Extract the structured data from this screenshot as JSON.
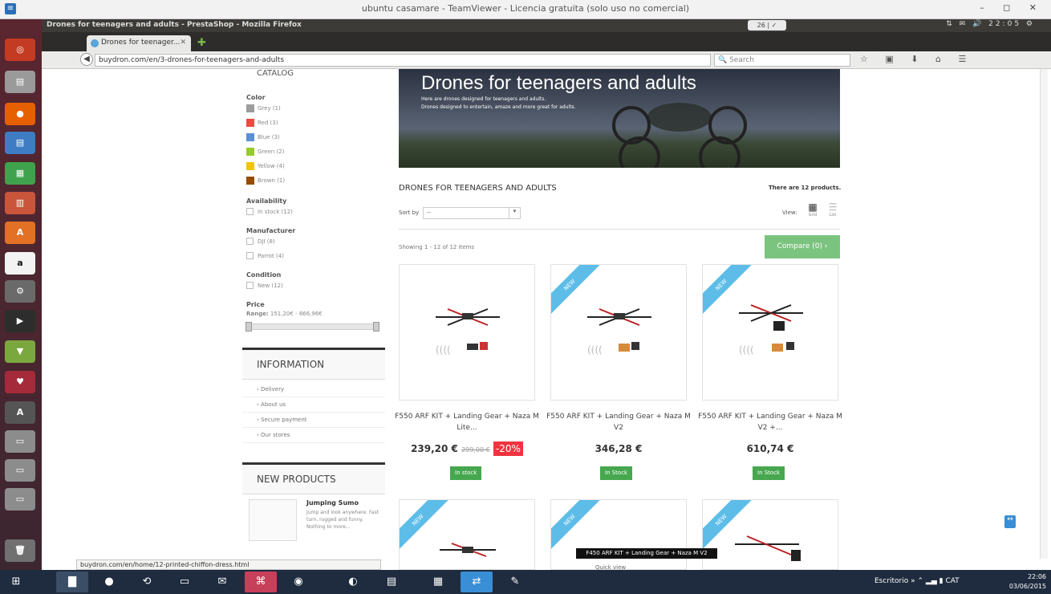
{
  "outer_window": {
    "title": "ubuntu casamare - TeamViewer - Licencia gratuita (solo uso no comercial)",
    "icon": "teamviewer-icon"
  },
  "firefox": {
    "window_title": "Drones for teenagers and adults - PrestaShop - Mozilla Firefox",
    "keyboard_indicator": "26 | ✓",
    "tray_time": "22:05",
    "tab_label": "Drones for teenager...",
    "url": "buydron.com/en/3-drones-for-teenagers-and-adults",
    "search_placeholder": "Search",
    "status_url": "buydron.com/en/home/12-printed-chiffon-dress.html"
  },
  "page": {
    "banner_title": "Drones for teenagers and adults",
    "banner_line1": "Here are drones designed for teenagers and adults.",
    "banner_line2": "Drones designed to entertain, amaze and more great for adults.",
    "category_heading": "DRONES FOR TEENAGERS AND ADULTS",
    "product_count": "There are 12 products.",
    "sort_label": "Sort by",
    "sort_value": "--",
    "view_label": "View:",
    "view_grid": "Grid",
    "view_list": "List",
    "showing": "Showing 1 - 12 of 12 items",
    "compare_button": "Compare (0)"
  },
  "sidebar": {
    "catalog_title": "CATALOG",
    "color_label": "Color",
    "colors": [
      {
        "label": "Grey (1)",
        "hex": "#9c9c9c"
      },
      {
        "label": "Red (3)",
        "hex": "#e84c3d"
      },
      {
        "label": "Blue (3)",
        "hex": "#5b8fd6"
      },
      {
        "label": "Green (2)",
        "hex": "#96ca2d"
      },
      {
        "label": "Yellow (4)",
        "hex": "#f1c40f"
      },
      {
        "label": "Brown (1)",
        "hex": "#964b00"
      }
    ],
    "availability_label": "Availability",
    "availability_option": "In stock (12)",
    "manufacturer_label": "Manufacturer",
    "manufacturers": [
      "DJI (8)",
      "Parrot (4)"
    ],
    "condition_label": "Condition",
    "condition_option": "New (12)",
    "price_label": "Price",
    "price_range_label": "Range:",
    "price_range": "151,20€ - 866,96€",
    "information_title": "INFORMATION",
    "information_items": [
      "Delivery",
      "About us",
      "Secure payment",
      "Our stores"
    ],
    "new_products_title": "NEW PRODUCTS",
    "new_product_name": "Jumping Sumo",
    "new_product_desc": "Jump and look anywhere. Fast turn, rugged and funny. Nothing to more..."
  },
  "products": [
    {
      "name": "F550 ARF KIT + Landing Gear + Naza M Lite...",
      "price": "239,20 €",
      "old_price": "299,00 €",
      "discount": "-20%",
      "stock": "In stock",
      "ribbon": ""
    },
    {
      "name": "F550 ARF KIT + Landing Gear + Naza M V2",
      "price": "346,28 €",
      "old_price": "",
      "discount": "",
      "stock": "In Stock",
      "ribbon": "NEW"
    },
    {
      "name": "F550 ARF KIT + Landing Gear + Naza M V2 +...",
      "price": "610,74 €",
      "old_price": "",
      "discount": "",
      "stock": "In Stock",
      "ribbon": "NEW"
    },
    {
      "ribbon": "NEW"
    },
    {
      "ribbon": "NEW"
    },
    {
      "ribbon": "NEW"
    }
  ],
  "tooltip": "F450 ARF KIT + Landing Gear + Naza M V2",
  "quick_view": "Quick view",
  "taskbar": {
    "desktop_label": "Escritorio",
    "time": "22:06",
    "date": "03/06/2015",
    "lang": "CAT"
  }
}
